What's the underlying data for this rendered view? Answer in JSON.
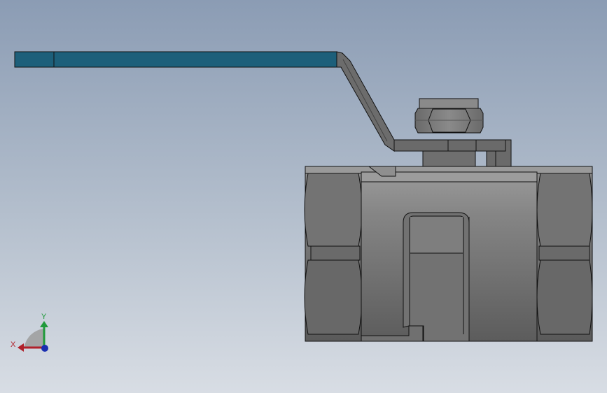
{
  "triad": {
    "x_label": "X",
    "y_label": "Y",
    "x_color": "#b0202a",
    "y_color": "#1f9a3a",
    "z_color": "#1a2fb0"
  },
  "colors": {
    "handle": "#1d5f7a",
    "body_light": "#8a8a8a",
    "body_mid": "#6e6e6e",
    "body_dark": "#555555",
    "edge": "#1a1a1a"
  }
}
